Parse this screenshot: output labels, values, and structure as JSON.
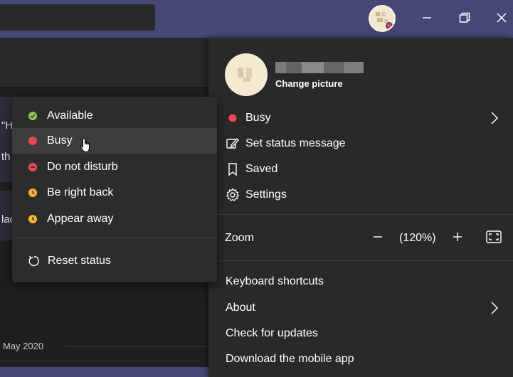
{
  "profile": {
    "change_picture_label": "Change picture"
  },
  "profile_menu": {
    "status_label": "Busy",
    "set_status_message_label": "Set status message",
    "saved_label": "Saved",
    "settings_label": "Settings",
    "zoom_label": "Zoom",
    "zoom_level": "(120%)",
    "keyboard_shortcuts_label": "Keyboard shortcuts",
    "about_label": "About",
    "check_updates_label": "Check for updates",
    "download_mobile_label": "Download the mobile app"
  },
  "status_menu": {
    "items": [
      {
        "label": "Available",
        "color": "#92c353"
      },
      {
        "label": "Busy",
        "color": "#e74856"
      },
      {
        "label": "Do not disturb",
        "color": "#e74856"
      },
      {
        "label": "Be right back",
        "color": "#fcb42c"
      },
      {
        "label": "Appear away",
        "color": "#fcb42c"
      }
    ],
    "reset_label": "Reset status"
  },
  "background": {
    "frag_1": "\"H",
    "frag_2": "th",
    "frag_3": "lac",
    "date_label": "May 2020"
  },
  "colors": {
    "titlebar": "#464775",
    "menu_bg": "#292929",
    "busy": "#e74856",
    "available": "#92c353",
    "away": "#fcb42c"
  },
  "icons": {
    "minimize": "minimize-icon",
    "restore": "restore-icon",
    "close": "close-icon",
    "edit_status": "edit-status-icon",
    "saved": "bookmark-icon",
    "settings": "gear-icon",
    "reset": "reset-icon"
  }
}
